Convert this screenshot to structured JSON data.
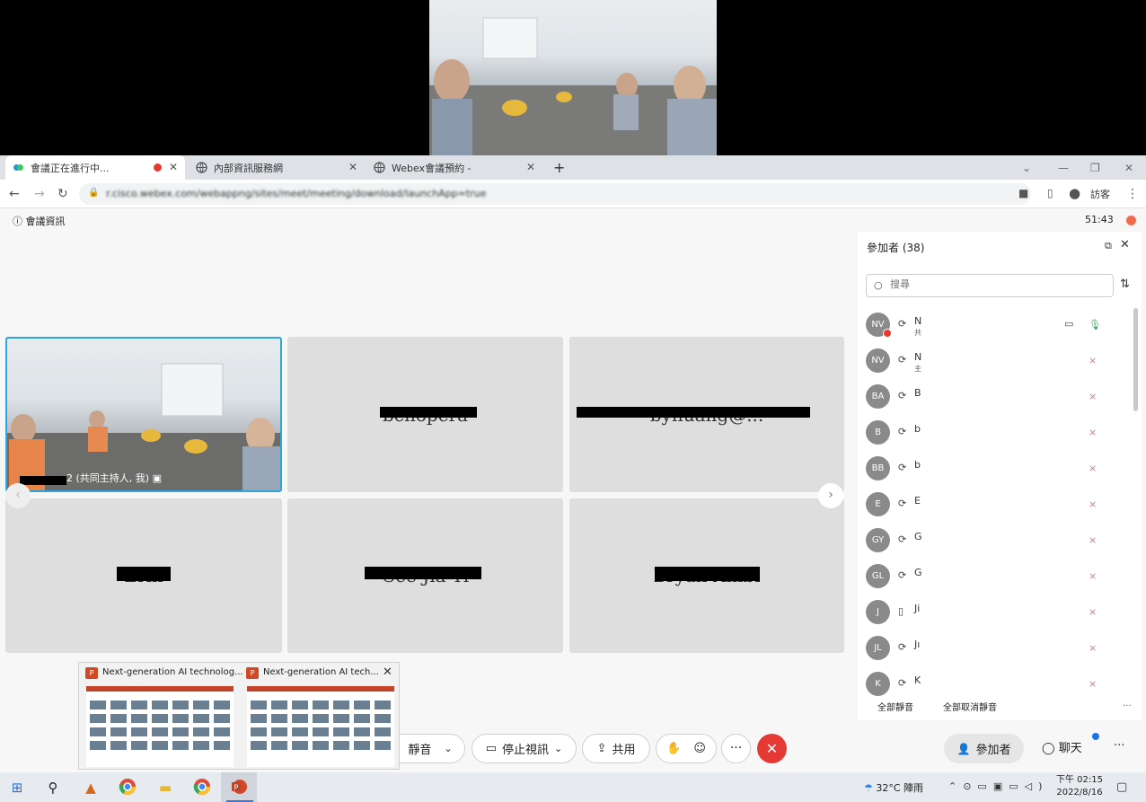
{
  "browser": {
    "tabs": [
      {
        "title": "會議正在進行中..."
      },
      {
        "title": "內部資訊服務網"
      },
      {
        "title": "Webex會議預約 -"
      }
    ],
    "new_tab": "+",
    "url": "r.cisco.webex.com/webappng/sites/meet/meeting/download/launchApp=true",
    "profile_label": "訪客"
  },
  "meeting": {
    "info_label": "會議資訊",
    "timer": "51:43",
    "tiles": [
      {
        "name": "",
        "label": "2 (共同主持人, 我)"
      },
      {
        "name": "bchopera"
      },
      {
        "name": "byhuang@..."
      },
      {
        "name": "Erin"
      },
      {
        "name": "Cee Jia Yi"
      },
      {
        "name": "Bryan Ambi"
      }
    ]
  },
  "participants": {
    "title": "參加者 (38)",
    "search_placeholder": "搜尋",
    "items": [
      {
        "initials": "NV",
        "name": "N",
        "sub": "共"
      },
      {
        "initials": "NV",
        "name": "N",
        "sub": "主"
      },
      {
        "initials": "BA",
        "name": "B",
        "sub": ""
      },
      {
        "initials": "B",
        "name": "b",
        "sub": ""
      },
      {
        "initials": "BB",
        "name": "b",
        "sub": ""
      },
      {
        "initials": "E",
        "name": "E",
        "sub": ""
      },
      {
        "initials": "GY",
        "name": "G",
        "sub": ""
      },
      {
        "initials": "GL",
        "name": "G",
        "sub": ""
      },
      {
        "initials": "J",
        "name": "Ji",
        "sub": ""
      },
      {
        "initials": "JL",
        "name": "Jı",
        "sub": ""
      },
      {
        "initials": "K",
        "name": "K",
        "sub": ""
      }
    ],
    "mute_all": "全部靜音",
    "unmute_all": "全部取消靜音",
    "more": "..."
  },
  "controls": {
    "mute": "靜音",
    "stop_video": "停止視訊",
    "share": "共用",
    "participants": "參加者",
    "chat": "聊天",
    "more": "···"
  },
  "thumbnails": [
    {
      "title": "Next-generation AI technolog..."
    },
    {
      "title": "Next-generation AI tech..."
    }
  ],
  "taskbar": {
    "weather": "32°C  陣雨",
    "time": "下午 02:15",
    "date": "2022/8/16"
  },
  "colors": {
    "accent": "#2fa5e0",
    "end_call": "#e53935",
    "muted_mic": "#e2777e"
  }
}
